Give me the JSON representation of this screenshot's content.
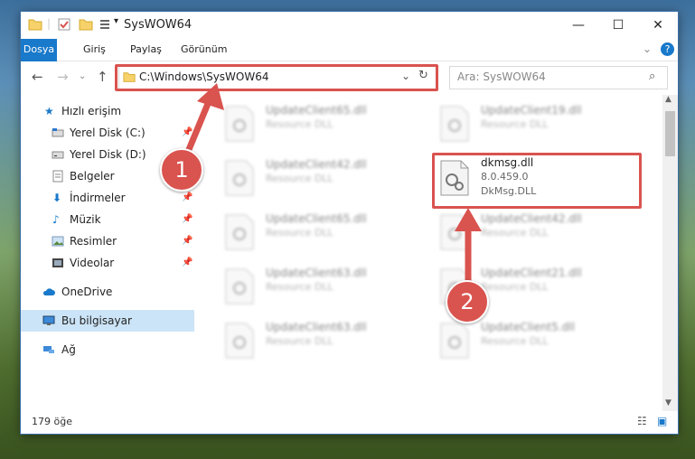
{
  "window": {
    "title": "SysWOW64"
  },
  "ribbon": {
    "tabs": [
      "Dosya",
      "Giriş",
      "Paylaş",
      "Görünüm"
    ]
  },
  "address": {
    "path": "C:\\Windows\\SysWOW64"
  },
  "search": {
    "placeholder": "Ara: SysWOW64"
  },
  "sidebar": {
    "items": [
      {
        "label": "Hızlı erişim",
        "icon": "star-icon",
        "pinned": false
      },
      {
        "label": "Yerel Disk (C:)",
        "icon": "drive-icon",
        "pinned": true
      },
      {
        "label": "Yerel Disk (D:)",
        "icon": "drive-icon",
        "pinned": false
      },
      {
        "label": "Belgeler",
        "icon": "document-icon",
        "pinned": true
      },
      {
        "label": "İndirmeler",
        "icon": "download-icon",
        "pinned": true
      },
      {
        "label": "Müzik",
        "icon": "music-icon",
        "pinned": true
      },
      {
        "label": "Resimler",
        "icon": "pictures-icon",
        "pinned": true
      },
      {
        "label": "Videolar",
        "icon": "video-icon",
        "pinned": true
      },
      {
        "label": "OneDrive",
        "icon": "cloud-icon",
        "pinned": false
      },
      {
        "label": "Bu bilgisayar",
        "icon": "computer-icon",
        "pinned": false
      },
      {
        "label": "Ağ",
        "icon": "network-icon",
        "pinned": false
      }
    ]
  },
  "files": [
    {
      "name": "UpdateClient65.dll",
      "type": "Resource DLL"
    },
    {
      "name": "UpdateClient19.dll",
      "type": "Resource DLL"
    },
    {
      "name": "UpdateClient42.dll",
      "type": "Resource DLL"
    },
    {
      "name": "dkmsg.dll",
      "version": "8.0.459.0",
      "desc": "DkMsg.DLL"
    },
    {
      "name": "UpdateClient65.dll",
      "type": "Resource DLL"
    },
    {
      "name": "UpdateClient42.dll",
      "type": "Resource DLL"
    },
    {
      "name": "UpdateClient63.dll",
      "type": "Resource DLL"
    },
    {
      "name": "UpdateClient21.dll",
      "type": "Resource DLL"
    },
    {
      "name": "UpdateClient63.dll",
      "type": "Resource DLL"
    },
    {
      "name": "UpdateClient5.dll",
      "type": "Resource DLL"
    }
  ],
  "status": {
    "count": "179 öğe"
  },
  "annotations": {
    "step1": "1",
    "step2": "2"
  },
  "colors": {
    "accent": "#1979ca",
    "highlight": "#d9534f",
    "selected": "#cce4f7"
  }
}
